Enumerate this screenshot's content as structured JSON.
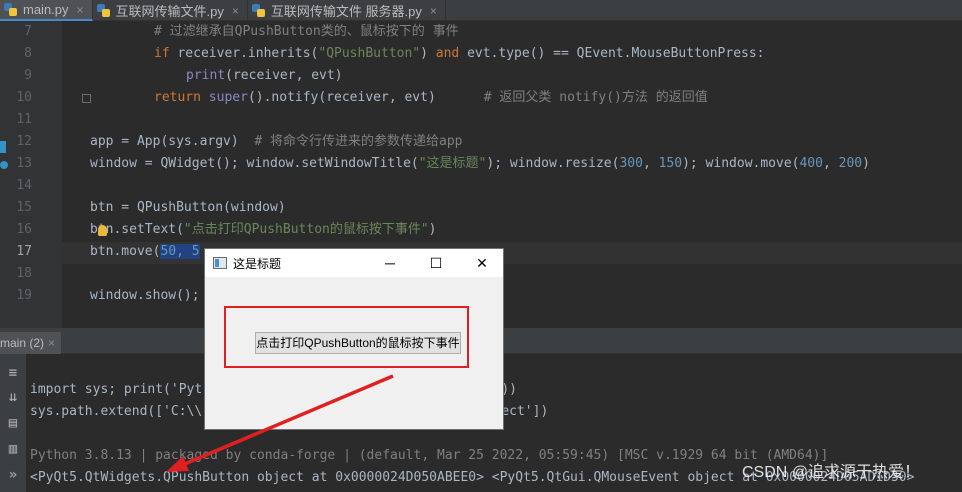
{
  "tabs": [
    {
      "label": "main.py",
      "active": true
    },
    {
      "label": "互联网传输文件.py",
      "active": false
    },
    {
      "label": "互联网传输文件 服务器.py",
      "active": false
    }
  ],
  "line_numbers": [
    "7",
    "8",
    "9",
    "10",
    "11",
    "12",
    "13",
    "14",
    "15",
    "16",
    "17",
    "18",
    "19"
  ],
  "code": {
    "l7_comment": "# 过滤继承自QPushButton类的、鼠标按下的 事件",
    "l8_if": "if",
    "l8_a": " receiver.inherits(",
    "l8_str": "\"QPushButton\"",
    "l8_b": ") ",
    "l8_and": "and",
    "l8_c": " evt.type() == QEvent.MouseButtonPress:",
    "l9_print": "print",
    "l9_rest": "(receiver, evt)",
    "l10_return": "return",
    "l10_a": " ",
    "l10_super": "super",
    "l10_b": "().notify(receiver, evt)",
    "l10_comment": "# 返回父类 notify()方法 的返回值",
    "l12_code": "app = App(sys.argv)  ",
    "l12_comment": "# 将命令行传进来的参数传递给app",
    "l13_a": "window = QWidget(); window.setWindowTitle(",
    "l13_str": "\"这是标题\"",
    "l13_b": "); window.resize(",
    "l13_n1": "300",
    "l13_c": ", ",
    "l13_n2": "150",
    "l13_d": "); window.move(",
    "l13_n3": "400",
    "l13_e": ", ",
    "l13_n4": "200",
    "l13_f": ")",
    "l15_code": "btn = QPushButton(window)",
    "l16_a": "btn.setText(",
    "l16_str": "\"点击打印QPushButton的鼠标按下事件\"",
    "l16_b": ")",
    "l17_a": "btn.move(",
    "l17_sel": "50, 5",
    "l19_code": "window.show();"
  },
  "run_tab": {
    "label": "main (2)",
    "close": "×"
  },
  "console": {
    "line1_a": "import sys; print('Pyt",
    "line1_b": "tform))",
    "line2_a": "sys.path.extend(['C:\\\\",
    "line2_b": "nProject'])",
    "line3": "Python 3.8.13 | packaged by conda-forge | (default, Mar 25 2022, 05:59:45) [MSC v.1929 64 bit (AMD64)]",
    "line4": "<PyQt5.QtWidgets.QPushButton object at 0x0000024D050ABEE0> <PyQt5.QtGui.QMouseEvent object at 0x0000024D05AD1D30>"
  },
  "qt_window": {
    "title": "这是标题",
    "minimize": "─",
    "maximize": "☐",
    "close": "✕",
    "button_label": "点击打印QPushButton的鼠标按下事件"
  },
  "watermark": "CSDN @追求源于热爱！",
  "colors": {
    "annotation": "#e02020",
    "keyword": "#cc7832",
    "string": "#6a8759",
    "number": "#6897bb",
    "comment": "#808080"
  }
}
